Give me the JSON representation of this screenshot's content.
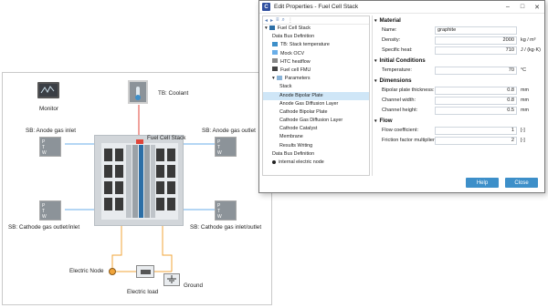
{
  "diagram": {
    "monitor_label": "Monitor",
    "coolant_label": "TB: Coolant",
    "stack_label": "Fuel Cell Stack",
    "anode_inlet_label": "SB: Anode gas inlet",
    "anode_outlet_label": "SB: Anode gas outlet",
    "cathode_outlet_inlet_label": "SB: Cathode gas outlet/inlet",
    "cathode_inlet_outlet_label": "SB: Cathode gas inlet/outlet",
    "electric_node_label": "Electric Node",
    "electric_load_label": "Electric load",
    "ground_label": "Ground",
    "port_letters": [
      "P",
      "T",
      "W"
    ]
  },
  "dialog": {
    "title": "Edit Properties - Fuel Cell Stack",
    "logo": "C",
    "tree": [
      {
        "label": "Fuel Cell Stack",
        "level": 0,
        "icon": "stack-icon"
      },
      {
        "label": "Data Bus Definition",
        "level": 1,
        "icon": ""
      },
      {
        "label": "TB: Stack temperature",
        "level": 1,
        "icon": "tb-icon"
      },
      {
        "label": "Mock OCV",
        "level": 1,
        "icon": "ocv-icon"
      },
      {
        "label": "HTC heatflow",
        "level": 1,
        "icon": "htc-icon"
      },
      {
        "label": "Fuel cell FMU",
        "level": 1,
        "icon": "fmu-icon"
      },
      {
        "label": "Parameters",
        "level": 1,
        "icon": "param-icon"
      },
      {
        "label": "Stack",
        "level": 2,
        "icon": ""
      },
      {
        "label": "Anode Bipolar Plate",
        "level": 2,
        "icon": "",
        "selected": true
      },
      {
        "label": "Anode Gas Diffusion Layer",
        "level": 2,
        "icon": ""
      },
      {
        "label": "Cathode Bipolar Plate",
        "level": 2,
        "icon": ""
      },
      {
        "label": "Cathode Gas Diffusion Layer",
        "level": 2,
        "icon": ""
      },
      {
        "label": "Cathode Catalyst",
        "level": 2,
        "icon": ""
      },
      {
        "label": "Membrane",
        "level": 2,
        "icon": ""
      },
      {
        "label": "Results Writing",
        "level": 2,
        "icon": ""
      },
      {
        "label": "Data Bus Definition",
        "level": 1,
        "icon": ""
      },
      {
        "label": "internal electric node",
        "level": 1,
        "icon": "dot-icon"
      }
    ],
    "sections": [
      {
        "title": "Material",
        "rows": [
          {
            "label": "Name:",
            "value": "graphite",
            "unit": "",
            "align": "left"
          },
          {
            "label": "Density:",
            "value": "2000",
            "unit": "kg / m³"
          },
          {
            "label": "Specific heat:",
            "value": "710",
            "unit": "J / (kg·K)"
          }
        ]
      },
      {
        "title": "Initial Conditions",
        "rows": [
          {
            "label": "Temperature:",
            "value": "70",
            "unit": "°C"
          }
        ]
      },
      {
        "title": "Dimensions",
        "rows": [
          {
            "label": "Bipolar plate thickness:",
            "value": "0.8",
            "unit": "mm"
          },
          {
            "label": "Channel width:",
            "value": "0.8",
            "unit": "mm"
          },
          {
            "label": "Channel height:",
            "value": "0.5",
            "unit": "mm"
          }
        ]
      },
      {
        "title": "Flow",
        "rows": [
          {
            "label": "Flow coefficient:",
            "value": "1",
            "unit": "[-]"
          },
          {
            "label": "Friction factor multiplier:",
            "value": "2",
            "unit": "[-]"
          }
        ]
      }
    ],
    "help_label": "Help",
    "close_label": "Close"
  },
  "colors": {
    "accent": "#3d8fc9",
    "pipe_blue": "#6aaee8",
    "pipe_red": "#e0453a",
    "pipe_orange": "#f0a43a",
    "stack_gray": "#d2d6da",
    "dark": "#3a3a3a"
  }
}
